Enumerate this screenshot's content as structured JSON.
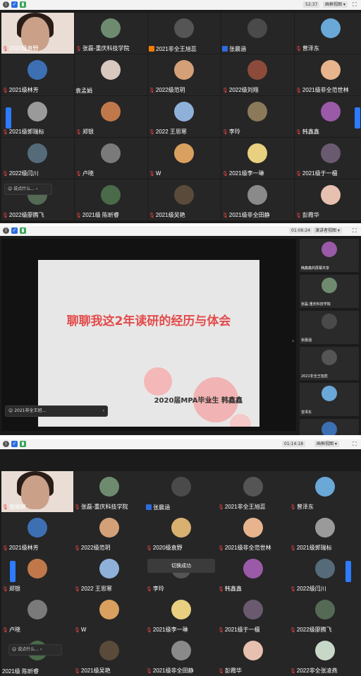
{
  "shot1": {
    "timer": "52:37",
    "view_label": "画框视图",
    "chat_hint": "说点什么...",
    "tiles": [
      {
        "name": "2020级袁野",
        "mic": "muted",
        "video": true,
        "color": "#c9a58e"
      },
      {
        "name": "张磊-重庆科技学院",
        "mic": "muted",
        "color": "#6e8b70"
      },
      {
        "name": "2021非全王旭蕊",
        "mic": "cam",
        "color": "#555555"
      },
      {
        "name": "张晨涵",
        "mic": "cam-blue",
        "color": "#4a4a4a"
      },
      {
        "name": "曾泽东",
        "mic": "muted",
        "color": "#6aa8d8"
      },
      {
        "name": "2021级林芳",
        "mic": "muted",
        "color": "#3d6fb3"
      },
      {
        "name": "袁孟娟",
        "mic": "none",
        "color": "#d9c8c0"
      },
      {
        "name": "2022级范玥",
        "mic": "muted",
        "color": "#d4a078"
      },
      {
        "name": "2022级刘翔",
        "mic": "muted",
        "color": "#8b4a3a"
      },
      {
        "name": "2021级非全范世林",
        "mic": "muted",
        "color": "#e8b48e"
      },
      {
        "name": "2021级郭瑞标",
        "mic": "muted",
        "color": "#9a9a9a"
      },
      {
        "name": "郑银",
        "mic": "muted",
        "color": "#c0784a"
      },
      {
        "name": "2022 王思寒",
        "mic": "muted",
        "color": "#8fb0d9"
      },
      {
        "name": "李玲",
        "mic": "muted",
        "color": "#8a7a5a"
      },
      {
        "name": "韩鑫鑫",
        "mic": "muted",
        "color": "#9a5aa8"
      },
      {
        "name": "2022级闫川",
        "mic": "muted",
        "color": "#556b7a"
      },
      {
        "name": "卢晓",
        "mic": "muted",
        "color": "#7a7a7a"
      },
      {
        "name": "W",
        "mic": "muted",
        "color": "#d9a060"
      },
      {
        "name": "2021级李一琳",
        "mic": "muted",
        "color": "#e8d080"
      },
      {
        "name": "2021级于一檀",
        "mic": "muted",
        "color": "#6a5a70"
      },
      {
        "name": "2022级廖腾飞",
        "mic": "muted",
        "color": "#556a55"
      },
      {
        "name": "2021级 陈昕睿",
        "mic": "muted",
        "color": "#4a6a4a"
      },
      {
        "name": "2021级吴艳",
        "mic": "muted",
        "color": "#5a4a3a"
      },
      {
        "name": "2021级非全田静",
        "mic": "muted",
        "color": "#8a8a8a"
      },
      {
        "name": "彭霞华",
        "mic": "muted",
        "color": "#e8c0b0"
      }
    ]
  },
  "shot2": {
    "timer": "01:06:24",
    "view_label": "演讲者视图",
    "slide_title": "聊聊我这2年读研的经历与体会",
    "slide_subtitle": "2020届MPA毕业生 韩鑫鑫",
    "chat_hint": "2021非全王旭...",
    "sidebar": [
      {
        "name": "韩鑫鑫的屏幕共享",
        "color": "#9a5aa8"
      },
      {
        "name": "张磊-重庆科技学院",
        "color": "#6e8b70"
      },
      {
        "name": "张晨涵",
        "color": "#4a4a4a"
      },
      {
        "name": "2021非全王旭蕊",
        "color": "#555555"
      },
      {
        "name": "曾泽东",
        "color": "#6aa8d8"
      },
      {
        "name": "",
        "color": "#3d6fb3"
      }
    ]
  },
  "shot3": {
    "timer": "01:14:18",
    "view_label": "画框视图",
    "chat_hint": "说点什么...",
    "toast": "切换成功",
    "tiles": [
      {
        "name": "张婉婷",
        "mic": "muted",
        "video": true,
        "color": "#c9a58e"
      },
      {
        "name": "张磊-重庆科技学院",
        "mic": "muted",
        "color": "#6e8b70"
      },
      {
        "name": "张晨涵",
        "mic": "cam-blue",
        "color": "#4a4a4a"
      },
      {
        "name": "2021非全王旭蕊",
        "mic": "muted",
        "color": "#555555"
      },
      {
        "name": "曾泽东",
        "mic": "muted",
        "color": "#6aa8d8"
      },
      {
        "name": "2021级林芳",
        "mic": "muted",
        "color": "#3d6fb3"
      },
      {
        "name": "2022级范玥",
        "mic": "muted",
        "color": "#d4a078"
      },
      {
        "name": "2020级袁野",
        "mic": "muted",
        "color": "#d8b070"
      },
      {
        "name": "2021级非全范世林",
        "mic": "muted",
        "color": "#e8b48e"
      },
      {
        "name": "2021级郭瑞标",
        "mic": "muted",
        "color": "#9a9a9a"
      },
      {
        "name": "郑银",
        "mic": "muted",
        "color": "#c0784a"
      },
      {
        "name": "2022 王思寒",
        "mic": "muted",
        "color": "#8fb0d9"
      },
      {
        "name": "李玲",
        "mic": "muted",
        "color": "#555555"
      },
      {
        "name": "韩鑫鑫",
        "mic": "muted",
        "color": "#9a5aa8"
      },
      {
        "name": "2022级闫川",
        "mic": "muted",
        "color": "#556b7a"
      },
      {
        "name": "卢晓",
        "mic": "muted",
        "color": "#7a7a7a"
      },
      {
        "name": "W",
        "mic": "muted",
        "color": "#d9a060"
      },
      {
        "name": "2021级李一琳",
        "mic": "muted",
        "color": "#e8d080"
      },
      {
        "name": "2021级于一檀",
        "mic": "muted",
        "color": "#6a5a70"
      },
      {
        "name": "2022级廖腾飞",
        "mic": "muted",
        "color": "#556a55"
      },
      {
        "name": "2021级 陈昕睿",
        "mic": "none",
        "color": "#4a6a4a"
      },
      {
        "name": "2021级吴艳",
        "mic": "muted",
        "color": "#5a4a3a"
      },
      {
        "name": "2021级非全田静",
        "mic": "muted",
        "color": "#8a8a8a"
      },
      {
        "name": "彭霞华",
        "mic": "muted",
        "color": "#e8c0b0"
      },
      {
        "name": "2022非全张凌燕",
        "mic": "muted",
        "color": "#c8d8c8"
      }
    ]
  }
}
